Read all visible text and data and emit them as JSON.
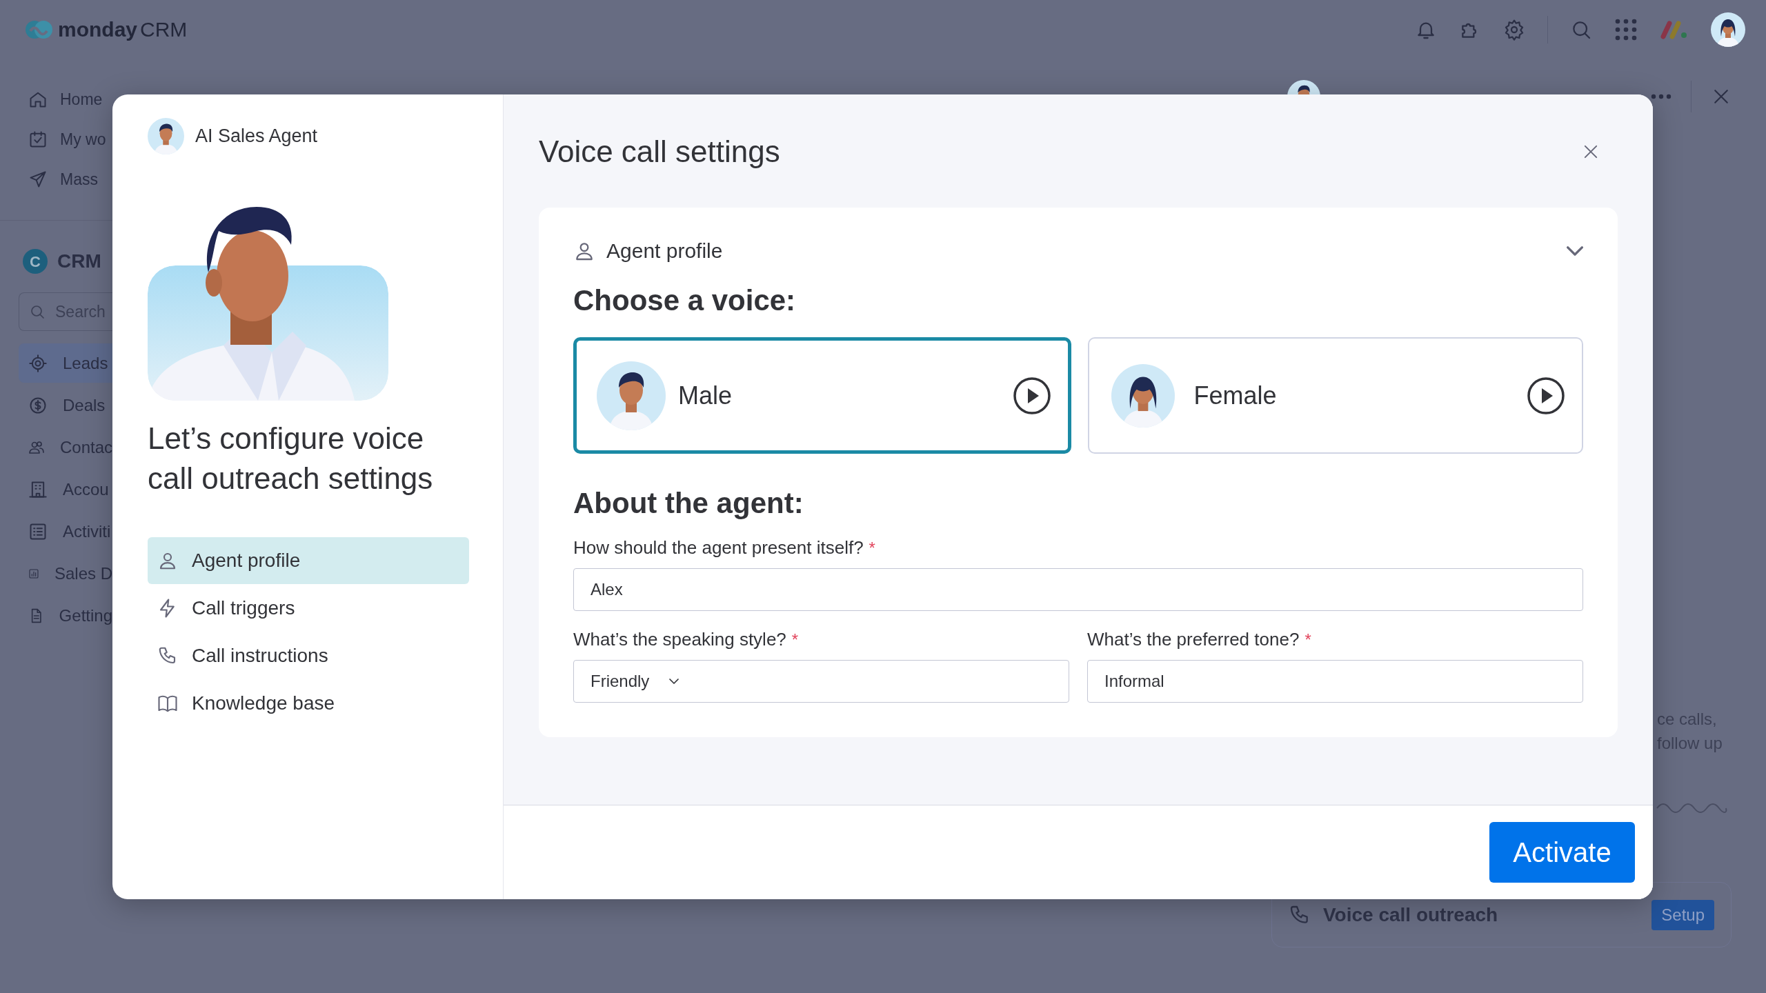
{
  "app_bar": {
    "logo_text": "monday",
    "product": "CRM"
  },
  "sidebar": {
    "items": [
      {
        "label": "Home"
      },
      {
        "label": "My wo"
      },
      {
        "label": "Mass"
      }
    ],
    "workspace": {
      "badge": "C",
      "name": "CRM"
    },
    "search": {
      "placeholder": "Search"
    },
    "boards": [
      {
        "label": "Leads",
        "selected": true
      },
      {
        "label": "Deals",
        "selected": false
      },
      {
        "label": "Contac",
        "selected": false
      },
      {
        "label": "Accou",
        "selected": false
      },
      {
        "label": "Activiti",
        "selected": false
      },
      {
        "label": "Sales D",
        "selected": false
      },
      {
        "label": "Getting",
        "selected": false
      }
    ]
  },
  "side_panel": {
    "text_lines": [
      "ce calls,",
      "follow up"
    ],
    "channels": [
      {
        "label": "Voice call outreach",
        "button": "Setup"
      }
    ]
  },
  "modal": {
    "agent_name": "AI Sales Agent",
    "heading": "Let’s configure voice call outreach settings",
    "steps": [
      {
        "label": "Agent profile",
        "selected": true
      },
      {
        "label": "Call triggers",
        "selected": false
      },
      {
        "label": "Call instructions",
        "selected": false
      },
      {
        "label": "Knowledge base",
        "selected": false
      }
    ],
    "title": "Voice call settings",
    "section": {
      "title": "Agent profile",
      "expanded": true
    },
    "voice_heading": "Choose a voice:",
    "voices": [
      {
        "label": "Male",
        "selected": true
      },
      {
        "label": "Female",
        "selected": false
      }
    ],
    "about_heading": "About the agent:",
    "fields": [
      {
        "kind": "text",
        "label": "How should the agent present itself?",
        "required_mark": "*",
        "value": "Alex"
      },
      {
        "kind": "select",
        "label": "What’s the speaking style?",
        "required_mark": "*",
        "value": "Friendly"
      },
      {
        "kind": "text",
        "label": "What’s the preferred tone?",
        "required_mark": "*",
        "value": "Informal"
      }
    ],
    "primary_button": "Activate"
  }
}
